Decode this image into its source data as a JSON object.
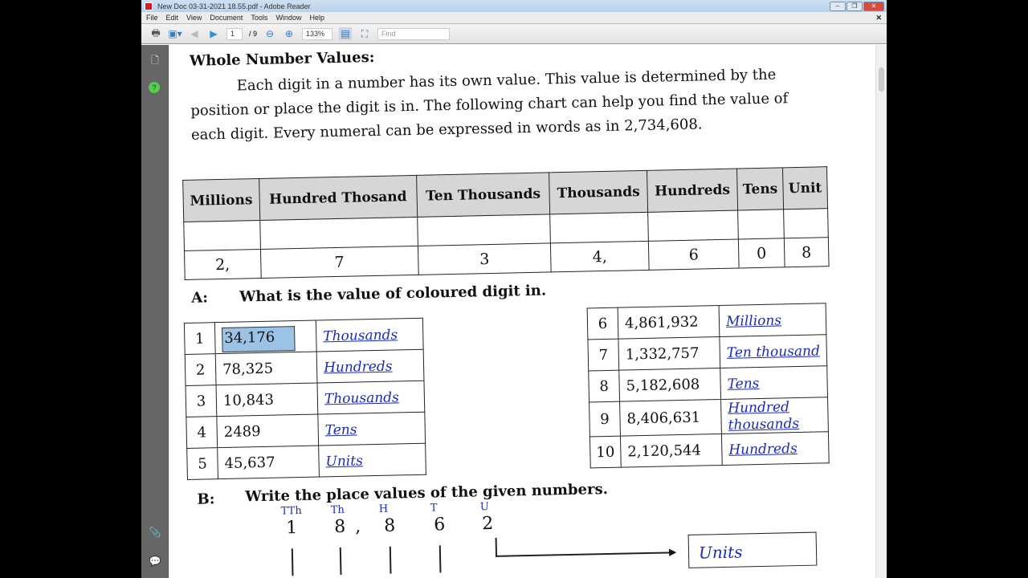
{
  "window": {
    "title": "New Doc 03-31-2021 18.55.pdf - Adobe Reader"
  },
  "menu": [
    "File",
    "Edit",
    "View",
    "Document",
    "Tools",
    "Window",
    "Help"
  ],
  "toolbar": {
    "page": "1",
    "page_total": "/ 9",
    "zoom": "133%",
    "find_placeholder": "Find"
  },
  "doc": {
    "heading": "Whole Number Values:",
    "paragraph": "Each digit in a number has its own value. This value is determined by the position or place the digit is in. The following chart can help you find the value of each digit. Every numeral can be expressed in words as in 2,734,608.",
    "chart_headers": [
      "Millions",
      "Hundred Thosand",
      "Ten Thousands",
      "Thousands",
      "Hundreds",
      "Tens",
      "Unit"
    ],
    "chart_digits": [
      "2,",
      "7",
      "3",
      "4,",
      "6",
      "0",
      "8"
    ],
    "section_a": "A:",
    "section_a_text": "What is the value of coloured digit in.",
    "a_left": [
      {
        "n": "1",
        "num": "34,176",
        "ans": "Thousands"
      },
      {
        "n": "2",
        "num": "78,325",
        "ans": "Hundreds"
      },
      {
        "n": "3",
        "num": "10,843",
        "ans": "Thousands"
      },
      {
        "n": "4",
        "num": "2489",
        "ans": "Tens"
      },
      {
        "n": "5",
        "num": "45,637",
        "ans": "Units"
      }
    ],
    "a_right": [
      {
        "n": "6",
        "num": "4,861,932",
        "ans": "Millions"
      },
      {
        "n": "7",
        "num": "1,332,757",
        "ans": "Ten thousand"
      },
      {
        "n": "8",
        "num": "5,182,608",
        "ans": "Tens"
      },
      {
        "n": "9",
        "num": "8,406,631",
        "ans": "Hundred thousands"
      },
      {
        "n": "10",
        "num": "2,120,544",
        "ans": "Hundreds"
      }
    ],
    "section_b": "B:",
    "section_b_text": "Write the place values of the given numbers.",
    "b_labels": [
      "TTh",
      "Th",
      "H",
      "T",
      "U"
    ],
    "b_digits": [
      "1",
      "8",
      ",",
      "8",
      "6",
      "2"
    ],
    "b_box": "Units"
  }
}
